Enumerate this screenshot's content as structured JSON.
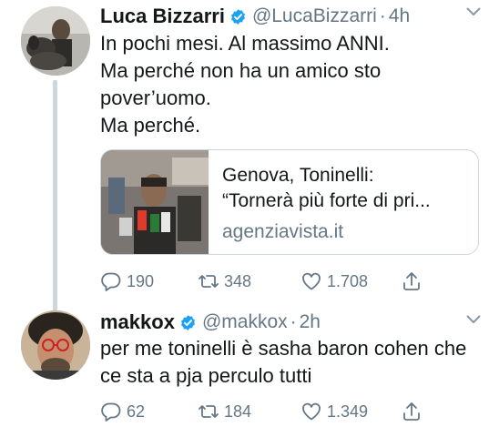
{
  "tweets": [
    {
      "name": "Luca Bizzarri",
      "handle": "@LucaBizzarri",
      "separator": "·",
      "time": "4h",
      "text_lines": [
        "In pochi mesi. Al massimo ANNI.",
        "Ma perché non ha un amico sto",
        "pover’uomo.",
        "Ma perché."
      ],
      "card": {
        "title_line1": "Genova, Toninelli:",
        "title_line2": "“Tornerà più forte di pri...",
        "domain": "agenziavista.it"
      },
      "actions": {
        "replies": "190",
        "retweets": "348",
        "likes": "1.708"
      }
    },
    {
      "name": "makkox",
      "handle": "@makkox",
      "separator": "·",
      "time": "2h",
      "text_lines": [
        "per me toninelli è sasha baron cohen che",
        "ce sta a pja perculo tutti"
      ],
      "actions": {
        "replies": "62",
        "retweets": "184",
        "likes": "1.349"
      }
    }
  ],
  "icons": {
    "verified": "verified-badge-icon",
    "more": "chevron-down-icon",
    "reply": "reply-icon",
    "retweet": "retweet-icon",
    "like": "heart-icon",
    "share": "share-icon"
  },
  "colors": {
    "verified_blue": "#1da1f2",
    "muted": "#657786",
    "text": "#14171a",
    "border": "#ccd6dd"
  }
}
